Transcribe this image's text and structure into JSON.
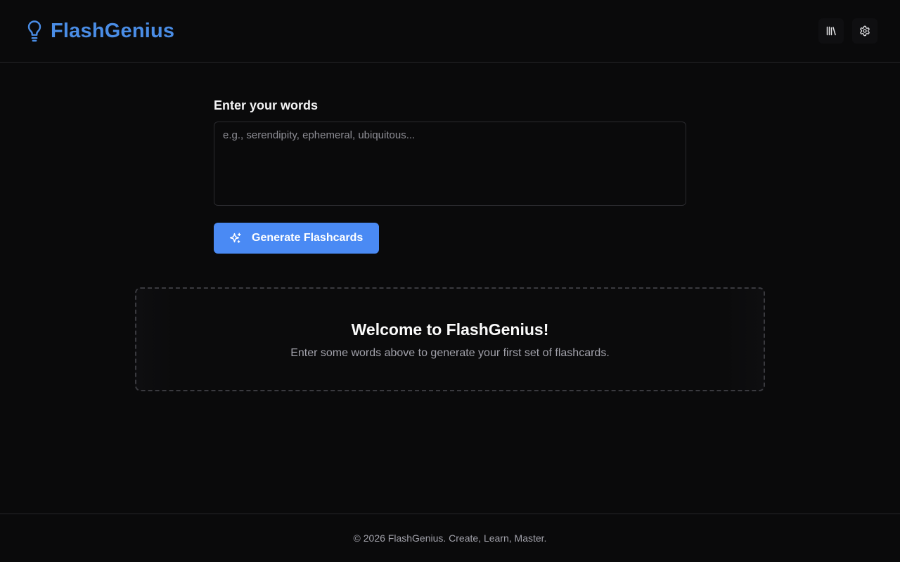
{
  "app": {
    "name": "FlashGenius",
    "logo_icon": "lightbulb-icon",
    "brand_color": "#4a8de6"
  },
  "header": {
    "actions": [
      {
        "icon": "library-icon"
      },
      {
        "icon": "gear-icon"
      }
    ]
  },
  "form": {
    "label": "Enter your words",
    "placeholder": "e.g., serendipity, ephemeral, ubiquitous...",
    "value": "",
    "generate_label": "Generate Flashcards",
    "generate_icon": "sparkles-icon",
    "button_color": "#4a8af4"
  },
  "welcome": {
    "title": "Welcome to FlashGenius!",
    "text": "Enter some words above to generate your first set of flashcards."
  },
  "footer": {
    "text": "© 2026 FlashGenius. Create, Learn, Master."
  }
}
